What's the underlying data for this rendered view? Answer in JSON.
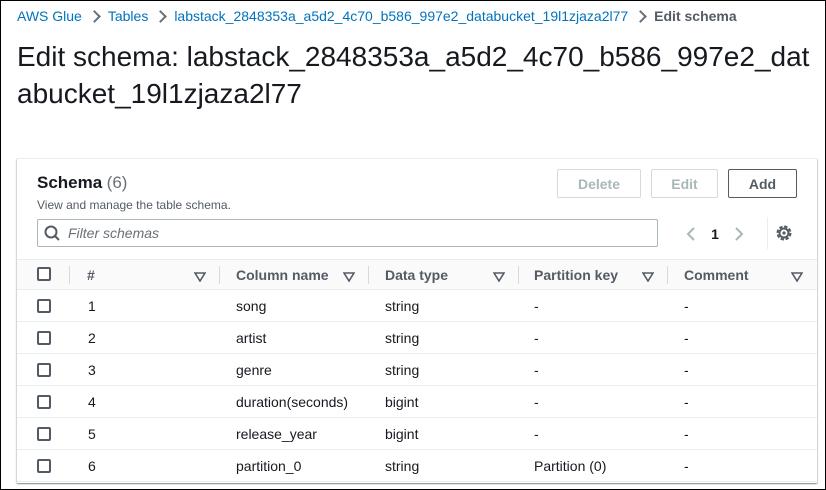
{
  "breadcrumb": {
    "items": [
      "AWS Glue",
      "Tables",
      "labstack_2848353a_a5d2_4c70_b586_997e2_databucket_19l1zjaza2l77"
    ],
    "current": "Edit schema"
  },
  "page": {
    "title": "Edit schema: labstack_2848353a_a5d2_4c70_b586_997e2_databucket_19l1zjaza2l77"
  },
  "panel": {
    "title": "Schema",
    "count": "(6)",
    "description": "View and manage the table schema.",
    "buttons": {
      "delete": "Delete",
      "edit": "Edit",
      "add": "Add"
    },
    "filter_placeholder": "Filter schemas",
    "page_number": "1"
  },
  "table": {
    "columns": [
      "#",
      "Column name",
      "Data type",
      "Partition key",
      "Comment"
    ],
    "rows": [
      {
        "num": "1",
        "name": "song",
        "type": "string",
        "partition": "-",
        "comment": "-"
      },
      {
        "num": "2",
        "name": "artist",
        "type": "string",
        "partition": "-",
        "comment": "-"
      },
      {
        "num": "3",
        "name": "genre",
        "type": "string",
        "partition": "-",
        "comment": "-"
      },
      {
        "num": "4",
        "name": "duration(seconds)",
        "type": "bigint",
        "partition": "-",
        "comment": "-"
      },
      {
        "num": "5",
        "name": "release_year",
        "type": "bigint",
        "partition": "-",
        "comment": "-"
      },
      {
        "num": "6",
        "name": "partition_0",
        "type": "string",
        "partition": "Partition (0)",
        "comment": "-"
      }
    ]
  },
  "icons": {
    "search": "search-icon",
    "prev": "chevron-left-icon",
    "next": "chevron-right-icon",
    "settings": "gear-icon",
    "sort": "caret-down-icon"
  },
  "colors": {
    "link": "#0073bb",
    "text": "#16191f",
    "muted": "#545b64",
    "disabled": "#aab7b8"
  }
}
